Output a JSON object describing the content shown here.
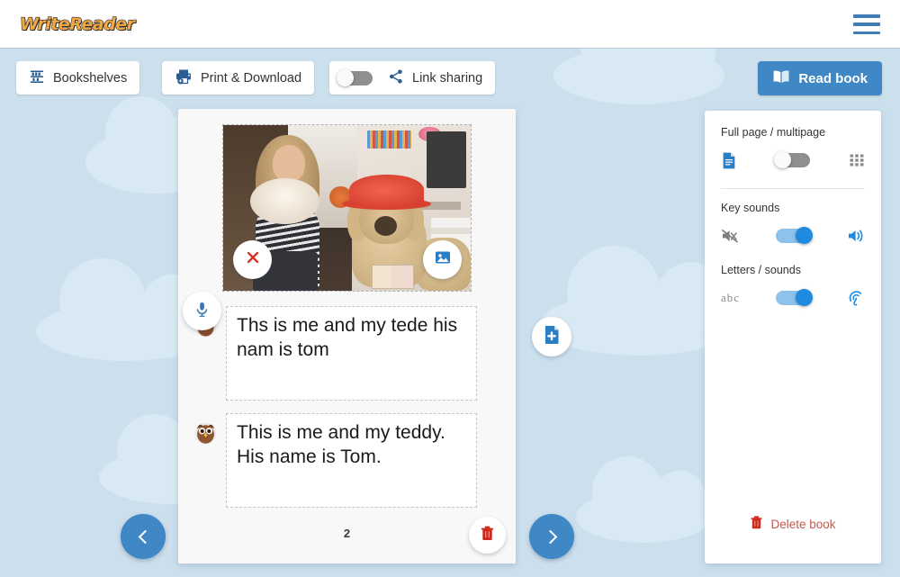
{
  "header": {
    "logo_text": "WriteReader",
    "menu_icon": "hamburger-menu-icon"
  },
  "toolbar": {
    "bookshelves_label": "Bookshelves",
    "bookshelves_icon": "bookshelf-icon",
    "print_label": "Print & Download",
    "print_icon": "printer-download-icon",
    "link_sharing_label": "Link sharing",
    "link_sharing_icon": "share-icon",
    "link_sharing_toggle": "off",
    "read_book_label": "Read book",
    "read_book_icon": "open-book-icon",
    "read_book_color": "#3f87c5"
  },
  "book": {
    "page_number": "2",
    "photo": {
      "alt": "girl sitting with a teddy dog wearing a red hat",
      "mic_icon": "microphone-icon",
      "remove_icon": "close-x-icon",
      "change_icon": "image-icon"
    },
    "child_text": "Ths is me and my tede his nam is tom",
    "child_avatar_icon": "child-owl-avatar-icon",
    "adult_text": "This is me and my teddy. His name is Tom.",
    "adult_avatar_icon": "adult-owl-avatar-icon",
    "delete_page_icon": "trash-icon",
    "prev_page_icon": "chevron-left-icon",
    "next_page_icon": "chevron-right-icon",
    "add_page_icon": "add-page-icon"
  },
  "settings": {
    "fullpage": {
      "label": "Full page / multipage",
      "left_icon": "document-page-icon",
      "right_icon": "grid-multipage-icon",
      "toggle": "off"
    },
    "key_sounds": {
      "label": "Key sounds",
      "left_icon": "speaker-muted-icon",
      "right_icon": "speaker-on-icon",
      "toggle": "on"
    },
    "letters_sounds": {
      "label": "Letters / sounds",
      "left_icon": "abc-letters-icon",
      "right_icon": "sound-wave-icon",
      "toggle": "on"
    },
    "delete_book_label": "Delete book",
    "delete_book_icon": "trash-icon",
    "delete_book_color": "#c4594e"
  },
  "theme": {
    "background": "#cbdfed",
    "cloud": "#d8e9f4",
    "accent_blue": "#3f87c5",
    "logo_orange": "#f0a843"
  }
}
